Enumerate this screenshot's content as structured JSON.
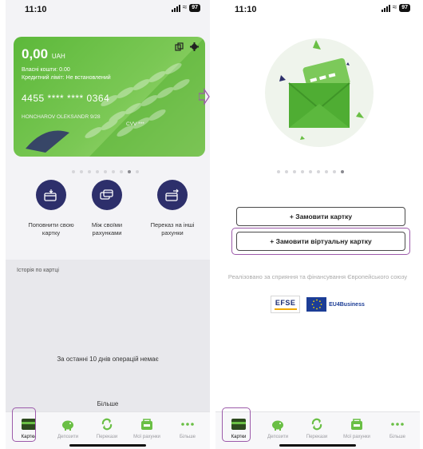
{
  "status_bar": {
    "time": "11:10",
    "battery": "97"
  },
  "card": {
    "balance": "0,00",
    "currency": "UAH",
    "own_funds": "Власні кошти: 0.00",
    "credit_limit": "Кредитний ліміт: Не встановлений",
    "number": "4455 **** **** 0364",
    "holder": "HONCHAROV OLEKSANDR 9/28",
    "cvv": "CVV ***"
  },
  "quick_actions": [
    {
      "label": "Поповнити свою картку"
    },
    {
      "label": "Між своїми рахунками"
    },
    {
      "label": "Переказ на інші рахунки"
    }
  ],
  "history": {
    "title": "Історія по картці",
    "empty_text": "За останні 10 днів операцій немає",
    "more_label": "Більше"
  },
  "tabbar": {
    "items": [
      {
        "label": "Картки"
      },
      {
        "label": "Депозити"
      },
      {
        "label": "Перекази"
      },
      {
        "label": "Мої рахунки"
      },
      {
        "label": "Більше"
      }
    ],
    "selected_index": 0
  },
  "order": {
    "order_card_label": "+ Замовити картку",
    "order_virtual_label": "+ Замовити віртуальну картку",
    "credit_text": "Реалізовано за сприяння та фінансування Європейського союзу",
    "logo_efse": "EFSE",
    "logo_eu4business": "EU4Business"
  },
  "colors": {
    "brand_green": "#6abf45",
    "navy": "#2d2f6b",
    "highlight": "#9c5aaa"
  },
  "icons": {
    "card_actions": [
      "copy-icon",
      "gear-icon"
    ],
    "tabbar": [
      "card-icon",
      "piggy-bank-icon",
      "transfer-arrows-icon",
      "wallet-icon",
      "more-dots-icon"
    ]
  }
}
